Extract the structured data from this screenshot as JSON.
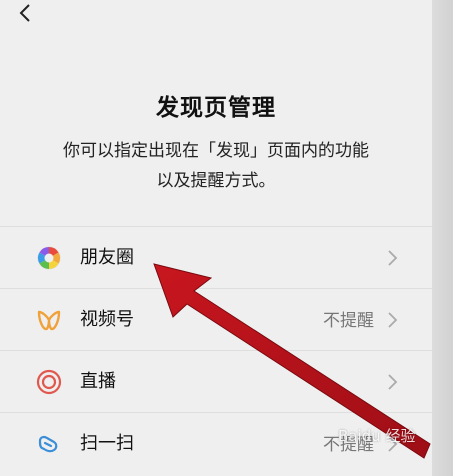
{
  "header": {
    "title": "发现页管理",
    "description_line1": "你可以指定出现在「发现」页面内的功能",
    "description_line2": "以及提醒方式。"
  },
  "items": [
    {
      "label": "朋友圈",
      "value": "",
      "icon": "moments-aperture-icon"
    },
    {
      "label": "视频号",
      "value": "不提醒",
      "icon": "channels-butterfly-icon"
    },
    {
      "label": "直播",
      "value": "",
      "icon": "live-ring-icon"
    },
    {
      "label": "扫一扫",
      "value": "不提醒",
      "icon": "scan-cube-icon"
    }
  ],
  "annotation": {
    "arrow_color": "#b5121b"
  },
  "watermark": {
    "text": "Baidu 经验"
  }
}
